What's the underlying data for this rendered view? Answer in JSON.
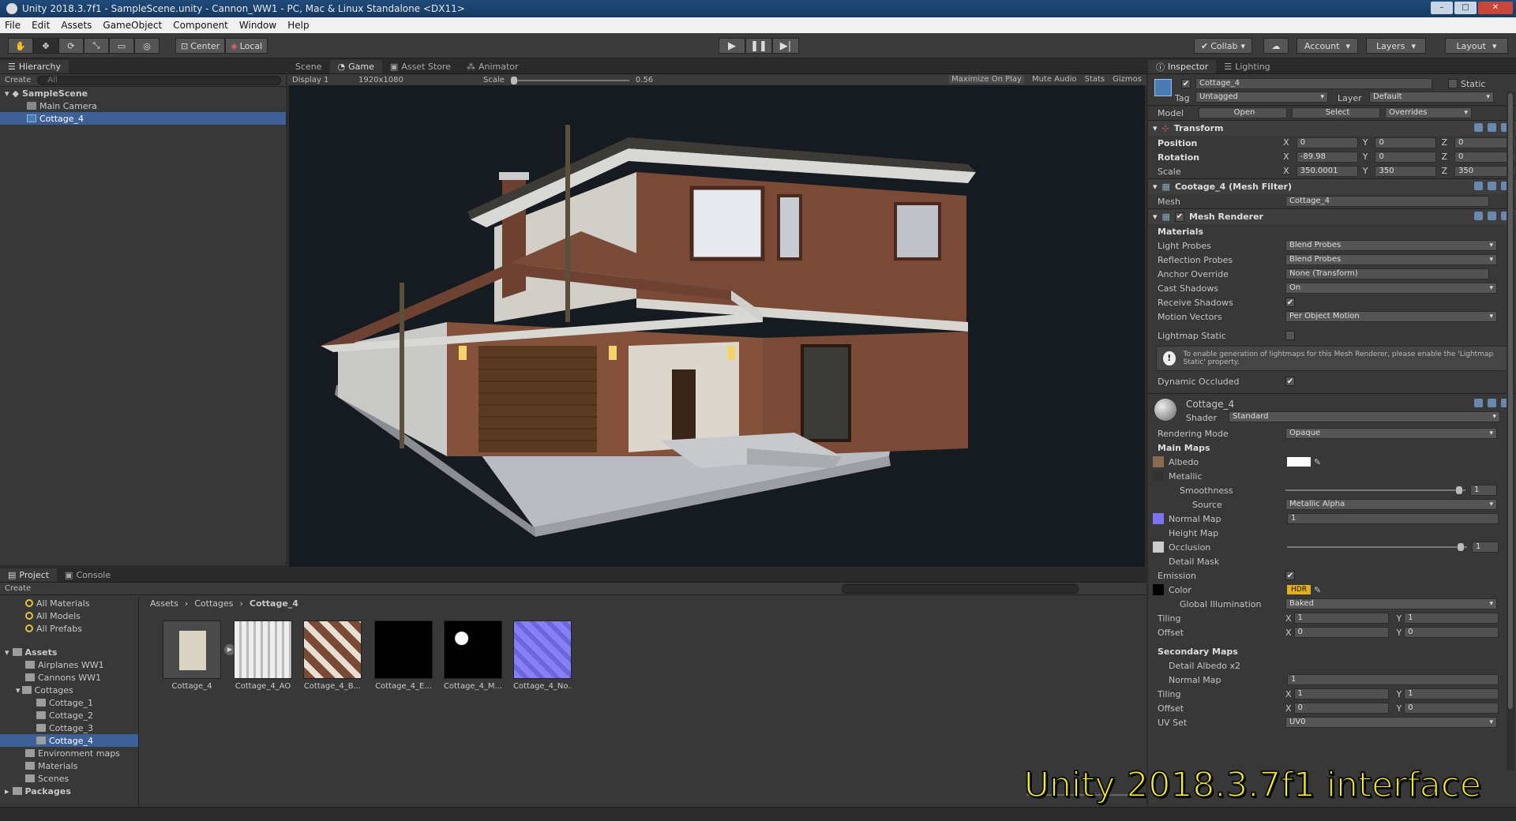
{
  "window": {
    "title": "Unity 2018.3.7f1 - SampleScene.unity - Cannon_WW1 - PC, Mac & Linux Standalone <DX11>"
  },
  "menu": [
    "File",
    "Edit",
    "Assets",
    "GameObject",
    "Component",
    "Window",
    "Help"
  ],
  "toolbar": {
    "pivot": "Center",
    "space": "Local",
    "collab": "Collab",
    "account": "Account",
    "layers": "Layers",
    "layout": "Layout"
  },
  "hierarchy": {
    "tab": "Hierarchy",
    "create": "Create",
    "search_placeholder": "All",
    "scene": "SampleScene",
    "items": [
      "Main Camera",
      "Cottage_4"
    ]
  },
  "game": {
    "tabs": [
      "Scene",
      "Game",
      "Asset Store",
      "Animator"
    ],
    "display": "Display 1",
    "resolution": "1920x1080",
    "scale_label": "Scale",
    "scale_value": "0.56",
    "options": [
      "Maximize On Play",
      "Mute Audio",
      "Stats",
      "Gizmos"
    ]
  },
  "inspector": {
    "tabs": [
      "Inspector",
      "Lighting"
    ],
    "object_name": "Cottage_4",
    "static_label": "Static",
    "tag_label": "Tag",
    "tag_value": "Untagged",
    "layer_label": "Layer",
    "layer_value": "Default",
    "model_label": "Model",
    "model_buttons": [
      "Open",
      "Select",
      "Overrides"
    ],
    "transform": {
      "title": "Transform",
      "position": {
        "label": "Position",
        "x": "0",
        "y": "0",
        "z": "0"
      },
      "rotation": {
        "label": "Rotation",
        "x": "-89.98",
        "y": "0",
        "z": "0"
      },
      "scale": {
        "label": "Scale",
        "x": "350.0001",
        "y": "350",
        "z": "350"
      }
    },
    "mesh_filter": {
      "title": "Cootage_4 (Mesh Filter)",
      "mesh_label": "Mesh",
      "mesh_value": "Cottage_4"
    },
    "mesh_renderer": {
      "title": "Mesh Renderer",
      "materials": "Materials",
      "rows": [
        {
          "label": "Light Probes",
          "value": "Blend Probes"
        },
        {
          "label": "Reflection Probes",
          "value": "Blend Probes"
        },
        {
          "label": "Anchor Override",
          "value": "None (Transform)"
        },
        {
          "label": "Cast Shadows",
          "value": "On"
        },
        {
          "label": "Receive Shadows",
          "value": ""
        },
        {
          "label": "Motion Vectors",
          "value": "Per Object Motion"
        }
      ],
      "lightmap_static": "Lightmap Static",
      "info": "To enable generation of lightmaps for this Mesh Renderer, please enable the 'Lightmap Static' property.",
      "dynamic_occluded": "Dynamic Occluded"
    },
    "material": {
      "name": "Cottage_4",
      "shader_label": "Shader",
      "shader_value": "Standard",
      "rendering_mode_label": "Rendering Mode",
      "rendering_mode_value": "Opaque",
      "main_maps": "Main Maps",
      "albedo": "Albedo",
      "metallic": "Metallic",
      "smoothness": "Smoothness",
      "smoothness_value": "1",
      "source_label": "Source",
      "source_value": "Metallic Alpha",
      "normal_map": "Normal Map",
      "normal_value": "1",
      "height_map": "Height Map",
      "occlusion": "Occlusion",
      "occlusion_value": "1",
      "detail_mask": "Detail Mask",
      "emission": "Emission",
      "color": "Color",
      "hdr": "HDR",
      "gi_label": "Global Illumination",
      "gi_value": "Baked",
      "tiling_label": "Tiling",
      "tiling_x": "1",
      "tiling_y": "1",
      "offset_label": "Offset",
      "offset_x": "0",
      "offset_y": "0",
      "secondary_maps": "Secondary Maps",
      "detail_albedo": "Detail Albedo x2",
      "normal_map2": "Normal Map",
      "normal2_value": "1",
      "tiling2_x": "1",
      "tiling2_y": "1",
      "offset2_x": "0",
      "offset2_y": "0",
      "uv_set_label": "UV Set",
      "uv_set_value": "UV0"
    }
  },
  "project": {
    "tabs": [
      "Project",
      "Console"
    ],
    "create": "Create",
    "favorites": [
      "All Materials",
      "All Models",
      "All Prefabs"
    ],
    "assets_root": "Assets",
    "folders": [
      {
        "name": "Airplanes WW1",
        "depth": 1
      },
      {
        "name": "Cannons WW1",
        "depth": 1
      },
      {
        "name": "Cottages",
        "depth": 1
      },
      {
        "name": "Cottage_1",
        "depth": 2
      },
      {
        "name": "Cottage_2",
        "depth": 2
      },
      {
        "name": "Cottage_3",
        "depth": 2
      },
      {
        "name": "Cottage_4",
        "depth": 2
      },
      {
        "name": "Environment maps",
        "depth": 1
      },
      {
        "name": "Materials",
        "depth": 1
      },
      {
        "name": "Scenes",
        "depth": 1
      }
    ],
    "packages": "Packages",
    "breadcrumb": [
      "Assets",
      "Cottages",
      "Cottage_4"
    ],
    "thumbnails": [
      "Cottage_4",
      "Cottage_4_AO",
      "Cottage_4_B...",
      "Cottage_4_E...",
      "Cottage_4_M...",
      "Cottage_4_No..."
    ]
  },
  "overlay_caption": "Unity 2018.3.7f1 interface",
  "colors": {
    "selection": "#3d6097",
    "panel": "#383838",
    "caption": "#f5ee2f"
  }
}
